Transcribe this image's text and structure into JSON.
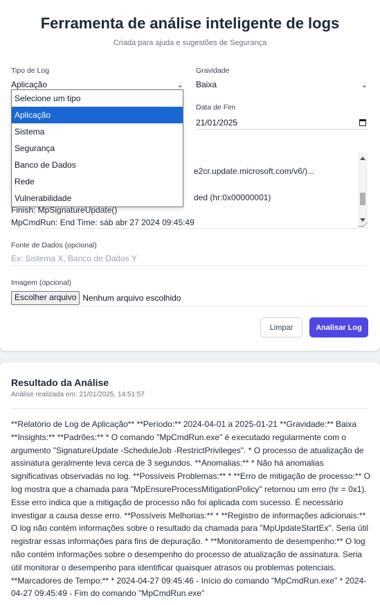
{
  "header": {
    "title": "Ferramenta de análise inteligente de logs",
    "subtitle": "Criada para ajuda e sugestões de Segurança"
  },
  "form": {
    "log_type": {
      "label": "Tipo de Log",
      "value": "Aplicação",
      "options": [
        "Selecione um tipo",
        "Aplicação",
        "Sistema",
        "Segurança",
        "Banco de Dados",
        "Rede",
        "Vulnerabilidade"
      ],
      "selected_index": 1
    },
    "severity": {
      "label": "Gravidade",
      "value": "Baixa"
    },
    "end_date": {
      "label": "Data de Fim",
      "value": "21/01/2025"
    },
    "log_content": {
      "line1": "e2cr.update.microsoft.com/v6/)...",
      "line2": "ded (hr:0x00000001)",
      "line3": "Finish: MpSignatureUpdate()",
      "line4": "MpCmdRun: End Time: sáb abr 27 2024 09:45:49"
    },
    "data_source": {
      "label": "Fonte de Dados (opcional)",
      "placeholder": "Ex: Sistema X, Banco de Dados Y"
    },
    "image": {
      "label": "Imagem (opcional)",
      "button": "Escolher arquivo",
      "status": "Nenhum arquivo escolhido"
    },
    "clear_label": "Limpar",
    "analyze_label": "Analisar Log"
  },
  "result": {
    "title": "Resultado da Análise",
    "timestamp": "Análise realizada em: 21/01/2025, 14:51:57",
    "body": "**Relatório de Log de Aplicação** **Período:** 2024-04-01 a 2025-01-21 **Gravidade:** Baixa **Insights:** **Padrões:** * O comando \"MpCmdRun.exe\" é executado regularmente com o argumento \"SignatureUpdate -ScheduleJob -RestrictPrivileges\". * O processo de atualização de assinatura geralmente leva cerca de 3 segundos. **Anomalias:** * Não há anomalias significativas observadas no log. **Possíveis Problemas:** * **Erro de mitigação de processo:** O log mostra que a chamada para \"MpEnsureProcessMitigationPolicy\" retornou um erro (hr = 0x1). Esse erro indica que a mitigação de processo não foi aplicada com sucesso. É necessário investigar a causa desse erro. **Possíveis Melhorias:** * **Registro de informações adicionais:** O log não contém informações sobre o resultado da chamada para \"MpUpdateStartEx\". Seria útil registrar essas informações para fins de depuração. * **Monitoramento de desempenho:** O log não contém informações sobre o desempenho do processo de atualização de assinatura. Seria útil monitorar o desempenho para identificar quaisquer atrasos ou problemas potenciais. **Marcadores de Tempo:** * 2024-04-27 09:45:46 - Início do comando \"MpCmdRun.exe\" * 2024-04-27 09:45:49 - Fim do comando \"MpCmdRun.exe\""
  },
  "colors": {
    "accent": "#4f46e5",
    "dropdown_highlight": "#1967d2"
  }
}
